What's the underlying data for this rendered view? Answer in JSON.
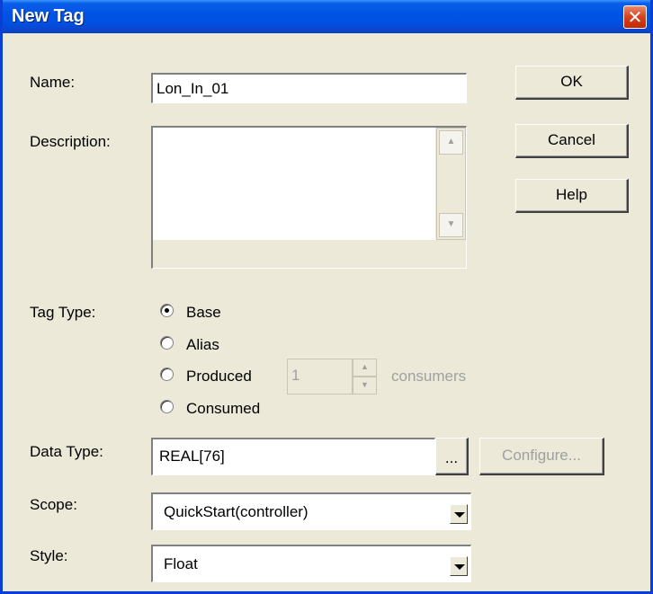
{
  "window": {
    "title": "New Tag",
    "close_glyph": "✕"
  },
  "name": {
    "label": "Name:",
    "value": "Lon_In_01"
  },
  "description": {
    "label": "Description:",
    "value": ""
  },
  "buttons": {
    "ok": "OK",
    "cancel": "Cancel",
    "help": "Help"
  },
  "tag_type": {
    "label": "Tag Type:",
    "options": [
      "Base",
      "Alias",
      "Produced",
      "Consumed"
    ],
    "selected": "Base",
    "consumers_value": "1",
    "consumers_label": "consumers"
  },
  "data_type": {
    "label": "Data Type:",
    "value": "REAL[76]",
    "browse": "...",
    "configure": "Configure..."
  },
  "scope": {
    "label": "Scope:",
    "value": "QuickStart(controller)"
  },
  "style": {
    "label": "Style:",
    "value": "Float"
  },
  "icons": {
    "close": "close-icon",
    "dropdown": "chevron-down-icon"
  },
  "colors": {
    "titlebar": "#0054e3",
    "face": "#ece9d8",
    "close": "#d6401c"
  }
}
